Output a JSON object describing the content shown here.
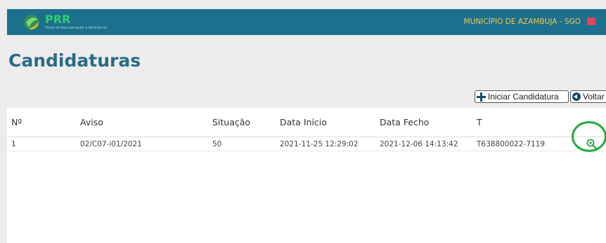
{
  "header": {
    "logo_text": "PRR",
    "logo_subtitle": "Plano de Recuperação e Resiliência",
    "entity": "MUNICÍPIO DE AZAMBUJA - SGO",
    "colors": {
      "bar": "#1d6f8e",
      "entity_text": "#f2c94c",
      "flag": "#e0455a"
    }
  },
  "page": {
    "title": "Candidaturas"
  },
  "toolbar": {
    "new_label": "Iniciar Candidatura",
    "back_label": "Voltar",
    "new_icon": "plus-icon",
    "back_icon": "back-circle-icon"
  },
  "table": {
    "columns": [
      "Nº",
      "Aviso",
      "Situação",
      "Data Início",
      "Data Fecho",
      "T"
    ],
    "rows": [
      {
        "num": "1",
        "aviso": "02/C07-i01/2021",
        "situacao": "50",
        "inicio": "2021-11-25 12:29:02",
        "fecho": "2021-12-06 14:13:42",
        "t": "T638800022-7119",
        "action_icon": "zoom-in-icon"
      }
    ],
    "highlight_color": "#1fae3a"
  }
}
